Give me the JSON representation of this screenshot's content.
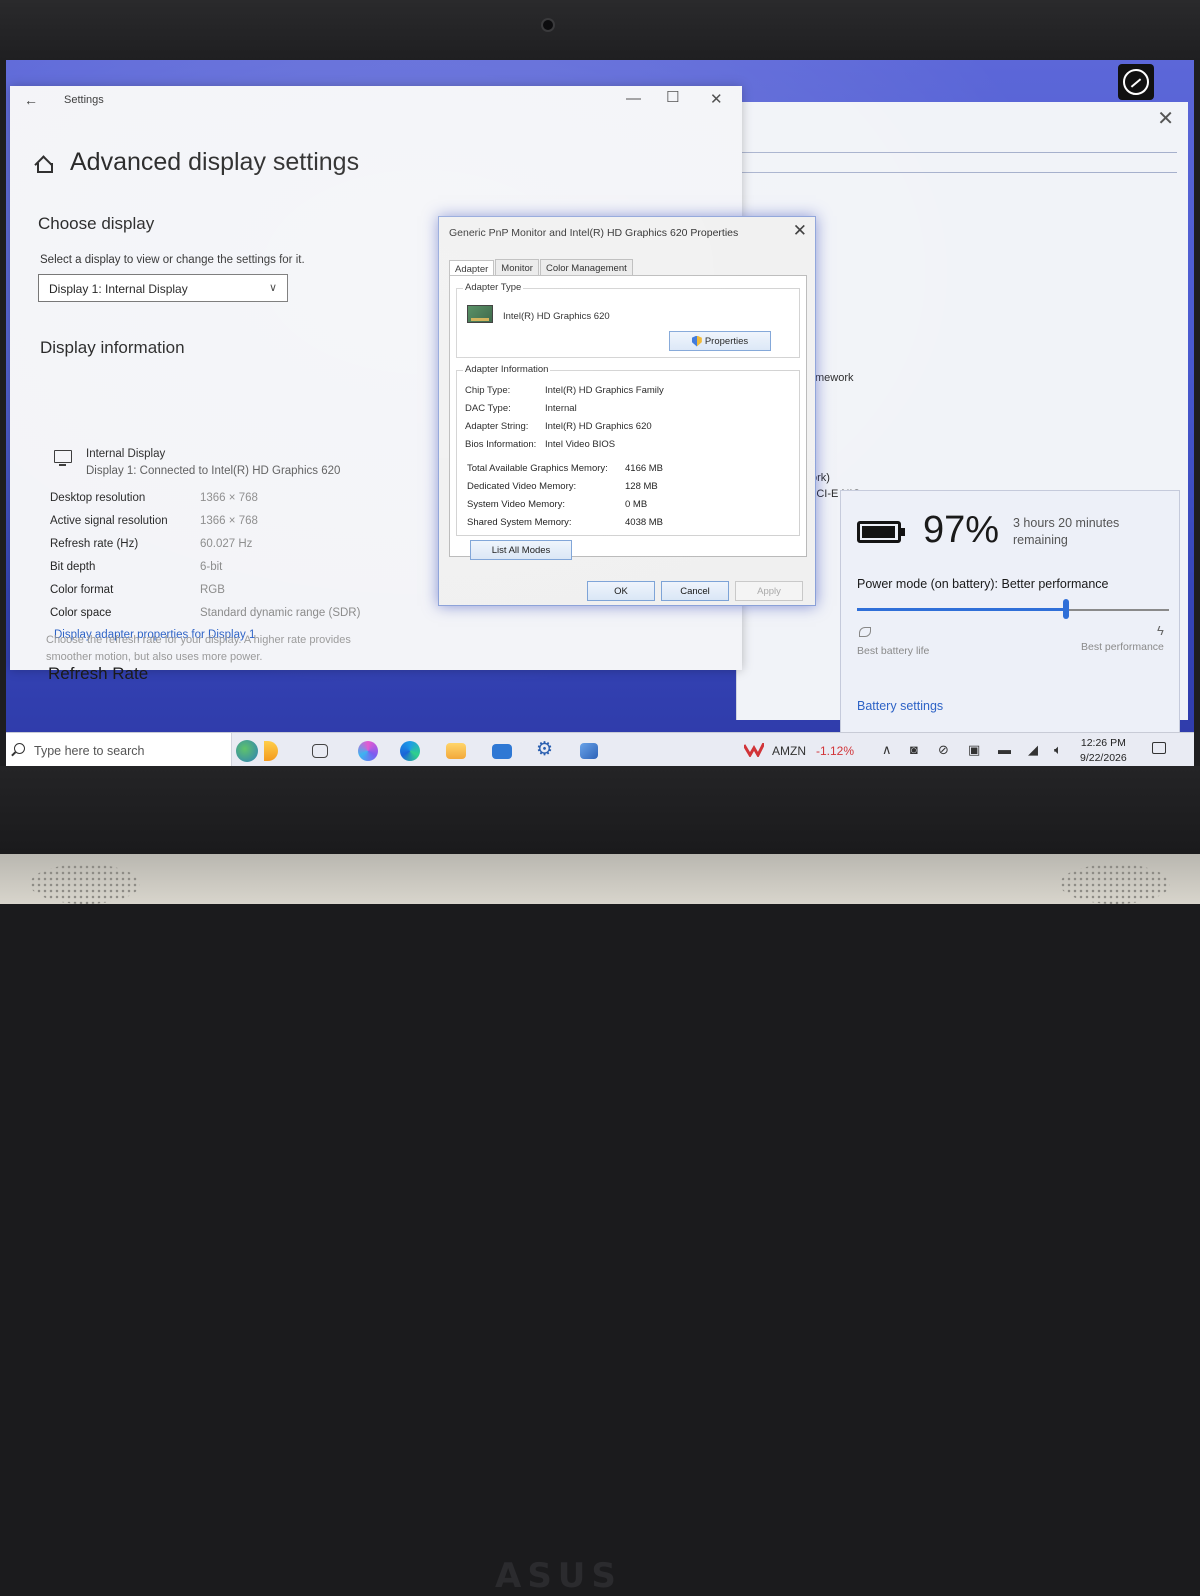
{
  "device": {
    "brand": "ASUS"
  },
  "settings": {
    "window_title": "Settings",
    "page_title": "Advanced display settings",
    "choose_display": {
      "heading": "Choose display",
      "instruction": "Select a display to view or change the settings for it.",
      "selected": "Display 1: Internal Display"
    },
    "display_info": {
      "heading": "Display information",
      "display_name": "Internal Display",
      "connection": "Display 1: Connected to Intel(R) HD Graphics 620",
      "rows": [
        {
          "label": "Desktop resolution",
          "value": "1366 × 768"
        },
        {
          "label": "Active signal resolution",
          "value": "1366 × 768"
        },
        {
          "label": "Refresh rate (Hz)",
          "value": "60.027 Hz"
        },
        {
          "label": "Bit depth",
          "value": "6-bit"
        },
        {
          "label": "Color format",
          "value": "RGB"
        },
        {
          "label": "Color space",
          "value": "Standard dynamic range (SDR)"
        }
      ],
      "adapter_link": "Display adapter properties for Display 1"
    },
    "refresh_rate": {
      "heading": "Refresh Rate",
      "description_line1": "Choose the refresh rate for your display. A higher rate provides",
      "description_line2": "smoother motion, but also uses more power."
    }
  },
  "background_window": {
    "fragment1": "mework",
    "fragment2": "ork)",
    "fragment3": "PCI-E NIC"
  },
  "properties_dialog": {
    "title": "Generic PnP Monitor and Intel(R) HD Graphics 620 Properties",
    "tabs": [
      "Adapter",
      "Monitor",
      "Color Management"
    ],
    "adapter_type": {
      "label": "Adapter Type",
      "name": "Intel(R) HD Graphics 620",
      "properties_button": "Properties"
    },
    "adapter_information": {
      "label": "Adapter Information",
      "rows": [
        {
          "label": "Chip Type:",
          "value": "Intel(R) HD Graphics Family"
        },
        {
          "label": "DAC Type:",
          "value": "Internal"
        },
        {
          "label": "Adapter String:",
          "value": "Intel(R) HD Graphics 620"
        },
        {
          "label": "Bios Information:",
          "value": "Intel Video BIOS"
        }
      ],
      "memory_rows": [
        {
          "label": "Total Available Graphics Memory:",
          "value": "4166 MB"
        },
        {
          "label": "Dedicated Video Memory:",
          "value": "128 MB"
        },
        {
          "label": "System Video Memory:",
          "value": "0 MB"
        },
        {
          "label": "Shared System Memory:",
          "value": "4038 MB"
        }
      ]
    },
    "list_modes_button": "List All Modes",
    "ok_button": "OK",
    "cancel_button": "Cancel",
    "apply_button": "Apply"
  },
  "battery_flyout": {
    "percent": "97%",
    "percent_value": 0.97,
    "remaining_line1": "3 hours 20 minutes",
    "remaining_line2": "remaining",
    "power_mode": "Power mode (on battery): Better performance",
    "slider_position": 0.67,
    "left_label": "Best battery life",
    "right_label": "Best performance",
    "settings_link": "Battery settings"
  },
  "taskbar": {
    "search_placeholder": "Type here to search",
    "stock_name": "AMZN",
    "stock_change": "-1.12%",
    "time": "12:26 PM",
    "date": "9/22/2026"
  },
  "colors": {
    "accent": "#2f6fd8",
    "link": "#2e63c6",
    "negative": "#d13438"
  }
}
